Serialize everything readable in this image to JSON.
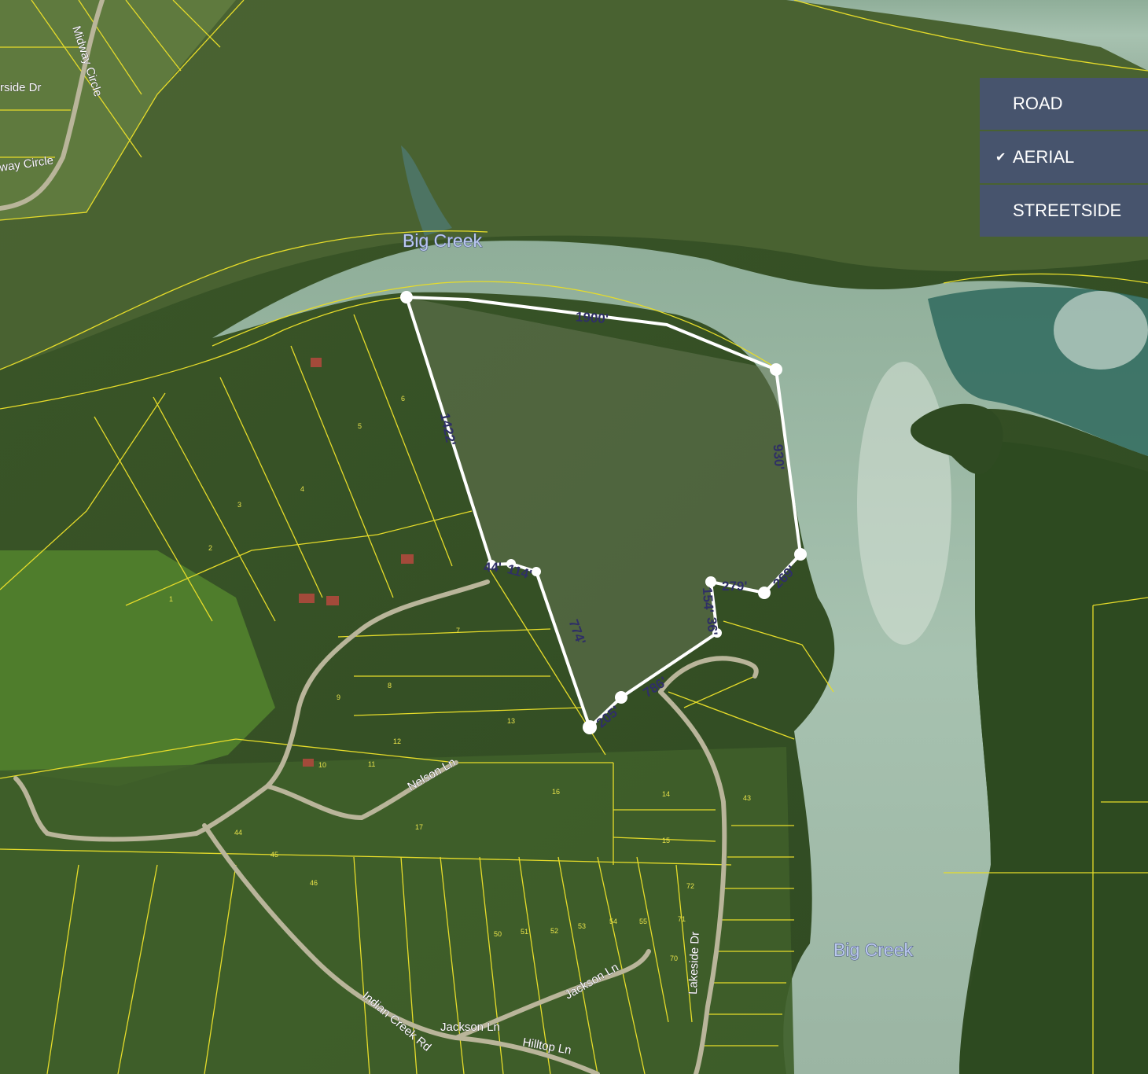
{
  "layer_menu": {
    "items": [
      {
        "label": "ROAD",
        "checked": false
      },
      {
        "label": "AERIAL",
        "checked": true
      },
      {
        "label": "STREETSIDE",
        "checked": false
      }
    ],
    "check_glyph": "✔"
  },
  "water_labels": {
    "big_creek_north": "Big Creek",
    "big_creek_south": "Big Creek"
  },
  "road_labels": {
    "midway_circle": "Midway Circle",
    "riverside_dr": "rside Dr",
    "midway_circle_2": "way Circle",
    "nelson_ln": "Nelson Ln",
    "indian_creek_rd": "Indian Creek Rd",
    "jackson_ln_1": "Jackson Ln",
    "jackson_ln_2": "Jackson Ln",
    "hilltop_ln": "Hilltop Ln",
    "lakeside_dr": "Lakeside Dr"
  },
  "dimensions": {
    "d1900": "1900'",
    "d1422": "1422'",
    "d930": "930'",
    "d269": "269'",
    "d279": "279'",
    "d154": "154'",
    "d36": "36'",
    "d786": "786'",
    "d205": "205'",
    "d774": "774'",
    "d114": "114'",
    "d44": "44'"
  },
  "lot_numbers": {
    "l1": "1",
    "l2": "2",
    "l3": "3",
    "l4": "4",
    "l5": "5",
    "l6": "6",
    "l7": "7",
    "l8": "8",
    "l9": "9",
    "l10": "10",
    "l11": "11",
    "l12": "12",
    "l13": "13",
    "l14": "14",
    "l15": "15",
    "l16": "16",
    "l17": "17",
    "l43": "43",
    "l44": "44",
    "l45": "45",
    "l46": "46",
    "l50": "50",
    "l51": "51",
    "l52": "52",
    "l53": "53",
    "l54": "54",
    "l55": "55",
    "l70": "70",
    "l71": "71",
    "l72": "72"
  },
  "colors": {
    "parcel_line": "#e6dc2a",
    "boundary": "#ffffff",
    "water": "#9fb8a6",
    "forest": "#3f5a2a"
  }
}
